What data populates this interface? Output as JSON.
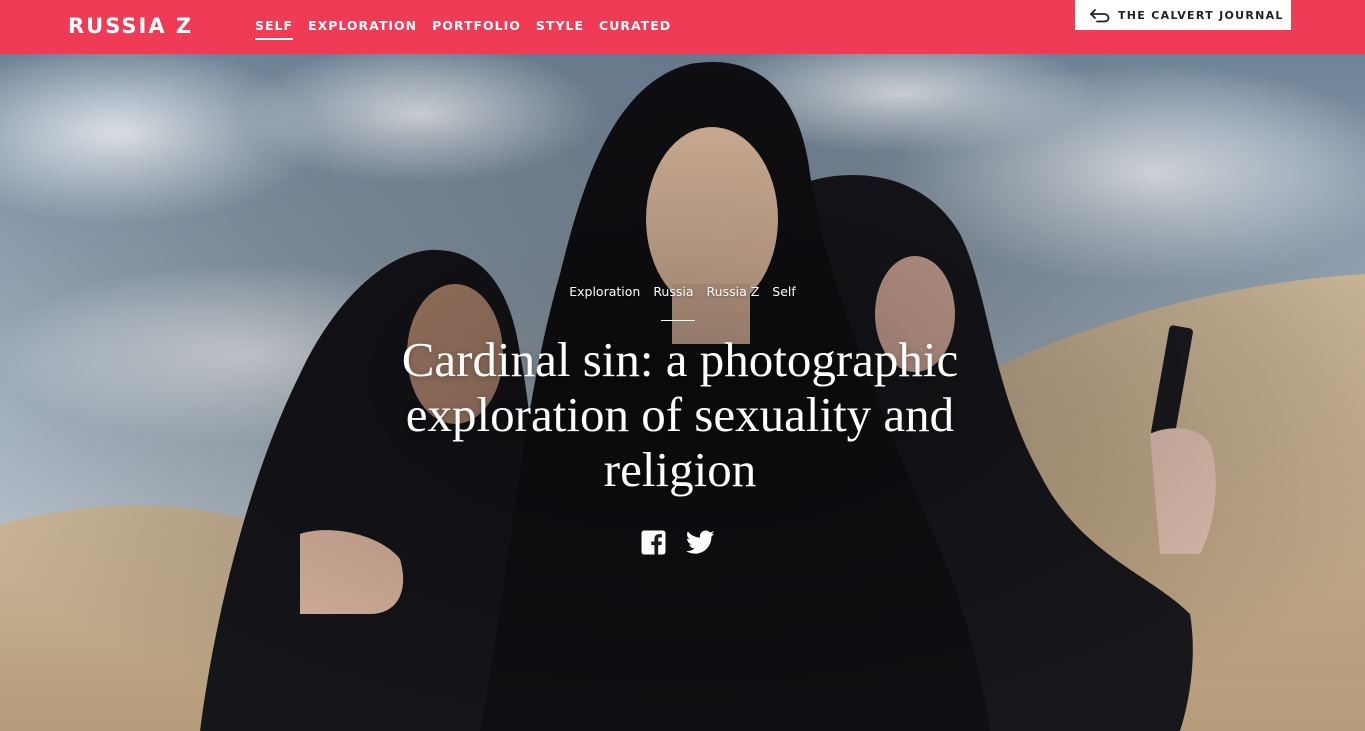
{
  "site": {
    "logo": "RUSSIA Z",
    "brand_color": "#ef3b55"
  },
  "nav": {
    "items": [
      {
        "label": "SELF",
        "active": true
      },
      {
        "label": "EXPLORATION",
        "active": false
      },
      {
        "label": "PORTFOLIO",
        "active": false
      },
      {
        "label": "STYLE",
        "active": false
      },
      {
        "label": "CURATED",
        "active": false
      }
    ]
  },
  "calvert": {
    "label": "THE CALVERT  JOURNAL",
    "icon": "return-arrow-icon"
  },
  "article": {
    "tags": [
      "Exploration",
      "Russia",
      "Russia Z",
      "Self"
    ],
    "title": "Cardinal sin: a photographic exploration of sexuality and religion",
    "share": [
      {
        "name": "facebook",
        "icon": "facebook-icon"
      },
      {
        "name": "twitter",
        "icon": "twitter-icon"
      }
    ]
  }
}
